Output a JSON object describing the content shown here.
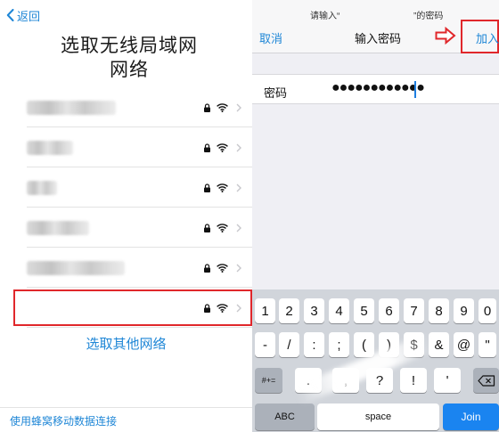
{
  "left": {
    "back_label": "返回",
    "title_line1": "选取无线局域网",
    "title_line2": "网络",
    "networks_count_note": "",
    "other_networks": "选取其他网络",
    "cellular": "使用蜂窝移动数据连接"
  },
  "right": {
    "prompt_part1": "请输入“",
    "prompt_part2": "”的密码",
    "cancel": "取消",
    "title": "输入密码",
    "join": "加入",
    "password_label": "密码",
    "password_value": "●●●●●●●●●●●●"
  },
  "keyboard": {
    "row1": [
      "1",
      "2",
      "3",
      "4",
      "5",
      "6",
      "7",
      "8",
      "9",
      "0"
    ],
    "row2": [
      "-",
      "/",
      ":",
      ";",
      "(",
      ")",
      "$",
      "&",
      "@",
      "\""
    ],
    "row3_left": "#+=",
    "row3": [
      ".",
      ",",
      "?",
      "!",
      "'"
    ],
    "abc": "ABC",
    "space": "space",
    "join": "Join"
  },
  "colors": {
    "accent_blue": "#1e86d6",
    "highlight_red": "#e0272b",
    "join_key_blue": "#1a84f0"
  }
}
